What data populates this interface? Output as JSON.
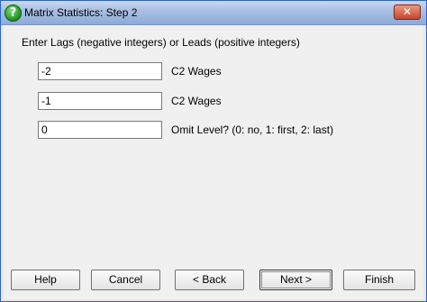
{
  "window": {
    "title": "Matrix Statistics: Step 2",
    "close_label": "✕"
  },
  "prompt": "Enter Lags (negative integers) or Leads (positive integers)",
  "fields": [
    {
      "value": "-2",
      "label": "C2 Wages"
    },
    {
      "value": "-1",
      "label": "C2 Wages"
    },
    {
      "value": "0",
      "label": "Omit Level? (0: no, 1: first, 2: last)"
    }
  ],
  "buttons": {
    "help": "Help",
    "cancel": "Cancel",
    "back": "< Back",
    "next": "Next >",
    "finish": "Finish"
  }
}
